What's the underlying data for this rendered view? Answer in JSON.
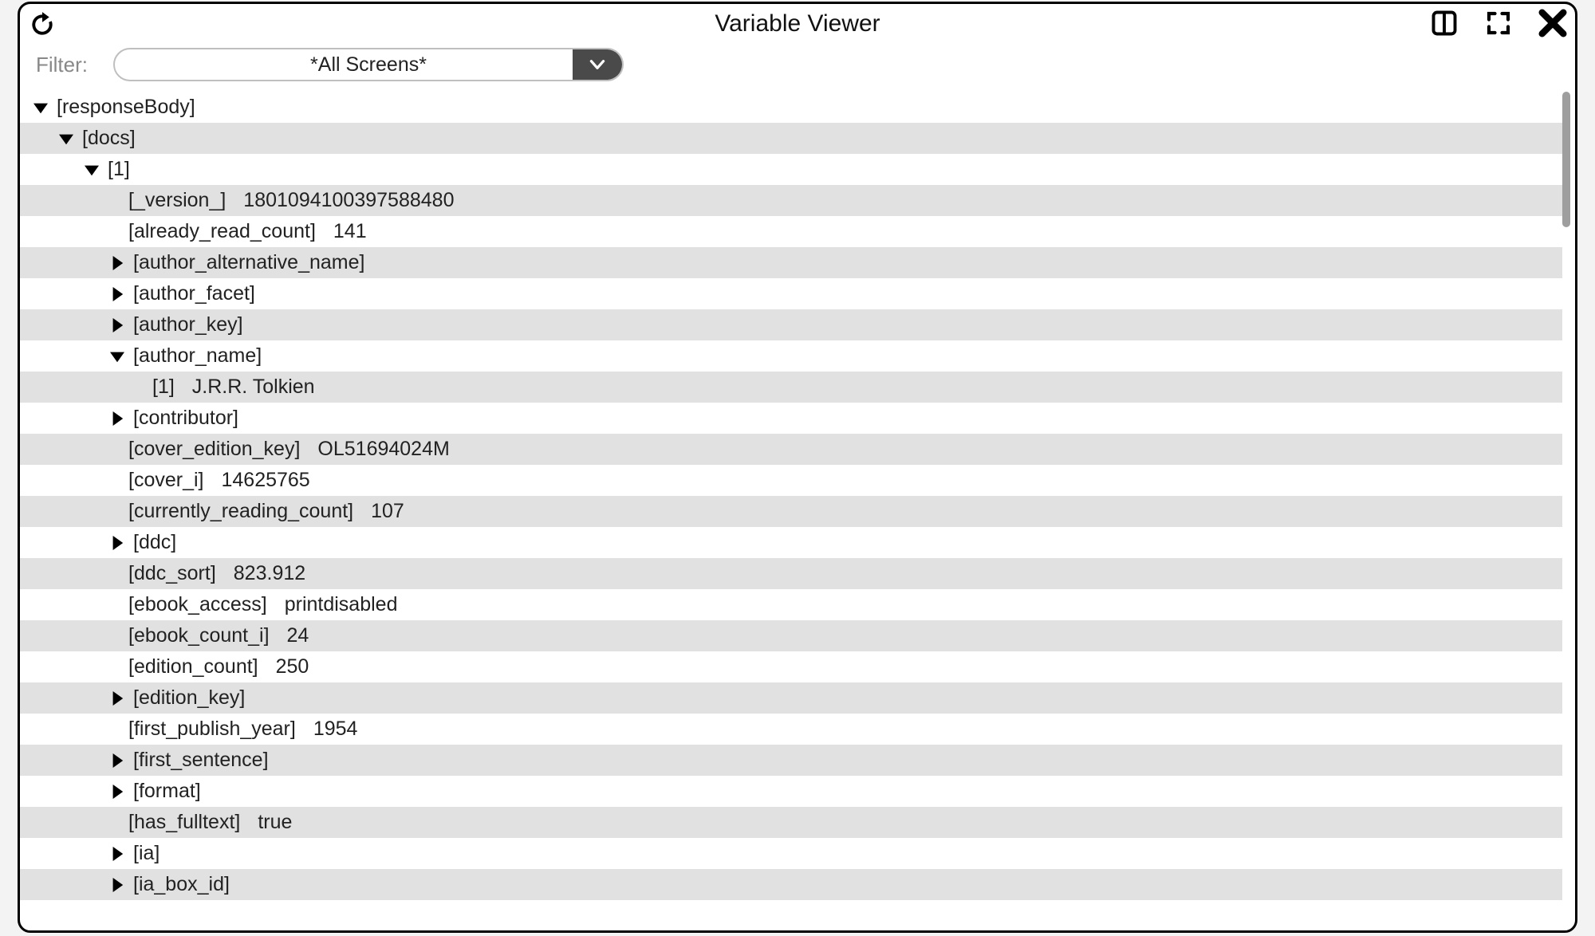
{
  "window": {
    "title": "Variable Viewer"
  },
  "filter": {
    "label": "Filter:",
    "value": "*All Screens*"
  },
  "rows": [
    {
      "id": "responseBody",
      "indent": 0,
      "arrow": "down",
      "key": "[responseBody]",
      "value": null,
      "zebra": false
    },
    {
      "id": "docs",
      "indent": 1,
      "arrow": "down",
      "key": "[docs]",
      "value": null,
      "zebra": true
    },
    {
      "id": "1",
      "indent": 2,
      "arrow": "down",
      "key": "[1]",
      "value": null,
      "zebra": false
    },
    {
      "id": "version",
      "indent": 3,
      "arrow": "none",
      "key": "[_version_]",
      "value": "1801094100397588480",
      "zebra": true
    },
    {
      "id": "already_read_count",
      "indent": 3,
      "arrow": "none",
      "key": "[already_read_count]",
      "value": "141",
      "zebra": false
    },
    {
      "id": "author_alternative_name",
      "indent": 3,
      "arrow": "right",
      "key": "[author_alternative_name]",
      "value": null,
      "zebra": true
    },
    {
      "id": "author_facet",
      "indent": 3,
      "arrow": "right",
      "key": "[author_facet]",
      "value": null,
      "zebra": false
    },
    {
      "id": "author_key",
      "indent": 3,
      "arrow": "right",
      "key": "[author_key]",
      "value": null,
      "zebra": true
    },
    {
      "id": "author_name",
      "indent": 3,
      "arrow": "down",
      "key": "[author_name]",
      "value": null,
      "zebra": false
    },
    {
      "id": "author_name_1",
      "indent": 4,
      "arrow": "none",
      "key": "[1]",
      "value": "J.R.R. Tolkien",
      "zebra": true
    },
    {
      "id": "contributor",
      "indent": 3,
      "arrow": "right",
      "key": "[contributor]",
      "value": null,
      "zebra": false
    },
    {
      "id": "cover_edition_key",
      "indent": 3,
      "arrow": "none",
      "key": "[cover_edition_key]",
      "value": "OL51694024M",
      "zebra": true
    },
    {
      "id": "cover_i",
      "indent": 3,
      "arrow": "none",
      "key": "[cover_i]",
      "value": "14625765",
      "zebra": false
    },
    {
      "id": "currently_reading_count",
      "indent": 3,
      "arrow": "none",
      "key": "[currently_reading_count]",
      "value": "107",
      "zebra": true
    },
    {
      "id": "ddc",
      "indent": 3,
      "arrow": "right",
      "key": "[ddc]",
      "value": null,
      "zebra": false
    },
    {
      "id": "ddc_sort",
      "indent": 3,
      "arrow": "none",
      "key": "[ddc_sort]",
      "value": "823.912",
      "zebra": true
    },
    {
      "id": "ebook_access",
      "indent": 3,
      "arrow": "none",
      "key": "[ebook_access]",
      "value": "printdisabled",
      "zebra": false
    },
    {
      "id": "ebook_count_i",
      "indent": 3,
      "arrow": "none",
      "key": "[ebook_count_i]",
      "value": "24",
      "zebra": true
    },
    {
      "id": "edition_count",
      "indent": 3,
      "arrow": "none",
      "key": "[edition_count]",
      "value": "250",
      "zebra": false
    },
    {
      "id": "edition_key",
      "indent": 3,
      "arrow": "right",
      "key": "[edition_key]",
      "value": null,
      "zebra": true
    },
    {
      "id": "first_publish_year",
      "indent": 3,
      "arrow": "none",
      "key": "[first_publish_year]",
      "value": "1954",
      "zebra": false
    },
    {
      "id": "first_sentence",
      "indent": 3,
      "arrow": "right",
      "key": "[first_sentence]",
      "value": null,
      "zebra": true
    },
    {
      "id": "format",
      "indent": 3,
      "arrow": "right",
      "key": "[format]",
      "value": null,
      "zebra": false
    },
    {
      "id": "has_fulltext",
      "indent": 3,
      "arrow": "none",
      "key": "[has_fulltext]",
      "value": "true",
      "zebra": true
    },
    {
      "id": "ia",
      "indent": 3,
      "arrow": "right",
      "key": "[ia]",
      "value": null,
      "zebra": false
    },
    {
      "id": "ia_box_id",
      "indent": 3,
      "arrow": "right",
      "key": "[ia_box_id]",
      "value": null,
      "zebra": true
    }
  ]
}
